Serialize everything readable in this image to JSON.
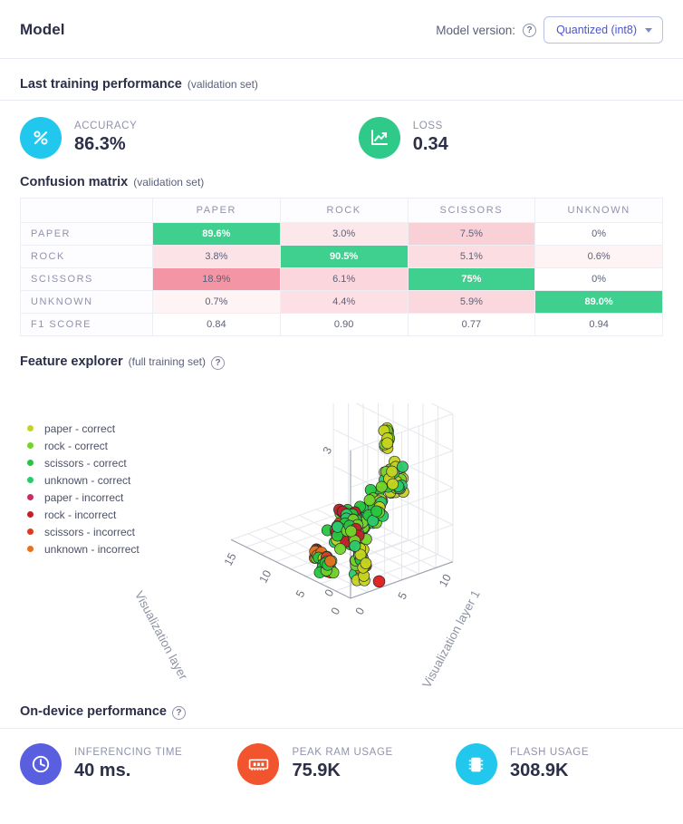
{
  "header": {
    "title": "Model",
    "version_label": "Model version:",
    "help_icon": "help-circle-icon",
    "dropdown_value": "Quantized (int8)",
    "dropdown_caret": "chevron-down-icon"
  },
  "training": {
    "section_title": "Last training performance",
    "section_sub": "(validation set)",
    "metrics": [
      {
        "label": "ACCURACY",
        "value": "86.3%",
        "icon": "percent-icon",
        "color": "#22c7ed"
      },
      {
        "label": "LOSS",
        "value": "0.34",
        "icon": "chart-line-icon",
        "color": "#2fc98a"
      }
    ]
  },
  "confusion": {
    "section_title": "Confusion matrix",
    "section_sub": "(validation set)",
    "columns": [
      "",
      "PAPER",
      "ROCK",
      "SCISSORS",
      "UNKNOWN"
    ],
    "rows": [
      {
        "label": "PAPER",
        "cells": [
          "89.6%",
          "3.0%",
          "7.5%",
          "0%"
        ]
      },
      {
        "label": "ROCK",
        "cells": [
          "3.8%",
          "90.5%",
          "5.1%",
          "0.6%"
        ]
      },
      {
        "label": "SCISSORS",
        "cells": [
          "18.9%",
          "6.1%",
          "75%",
          "0%"
        ]
      },
      {
        "label": "UNKNOWN",
        "cells": [
          "0.7%",
          "4.4%",
          "5.9%",
          "89.0%"
        ]
      },
      {
        "label": "F1 SCORE",
        "cells": [
          "0.84",
          "0.90",
          "0.77",
          "0.94"
        ]
      }
    ],
    "diagonal_color": "#3fcf8e",
    "error_color": "#f7c8cf"
  },
  "explorer": {
    "section_title": "Feature explorer",
    "section_sub": "(full training set)",
    "help_icon": "help-circle-icon",
    "legend": [
      {
        "label": "paper - correct",
        "color": "#c6d41f"
      },
      {
        "label": "rock - correct",
        "color": "#73d42a"
      },
      {
        "label": "scissors - correct",
        "color": "#26c63f"
      },
      {
        "label": "unknown - correct",
        "color": "#2bc96b"
      },
      {
        "label": "paper - incorrect",
        "color": "#cf2a68"
      },
      {
        "label": "rock - incorrect",
        "color": "#c41f2a"
      },
      {
        "label": "scissors - incorrect",
        "color": "#e0391f"
      },
      {
        "label": "unknown - incorrect",
        "color": "#e5721f"
      }
    ],
    "axes": {
      "x_label": "Visualization layer",
      "y_label": "Visualization layer 1",
      "x_ticks": [
        "0",
        "5",
        "10",
        "15"
      ],
      "y_ticks": [
        "0",
        "5",
        "10"
      ],
      "z_ticks": [
        "0",
        "3"
      ]
    }
  },
  "ondevice": {
    "section_title": "On-device performance",
    "help_icon": "help-circle-icon",
    "metrics": [
      {
        "label": "INFERENCING TIME",
        "value": "40 ms.",
        "icon": "clock-icon",
        "color": "#5a5fe0"
      },
      {
        "label": "PEAK RAM USAGE",
        "value": "75.9K",
        "icon": "ram-chip-icon",
        "color": "#f2542d"
      },
      {
        "label": "FLASH USAGE",
        "value": "308.9K",
        "icon": "microchip-icon",
        "color": "#22c7ed"
      }
    ]
  }
}
